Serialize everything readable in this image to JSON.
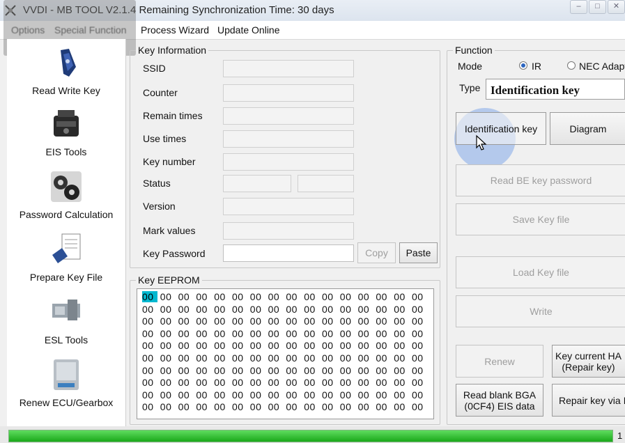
{
  "window": {
    "title": "VVDI - MB TOOL V2.1.4   Remaining Synchronization Time: 30 days"
  },
  "menu": {
    "items": [
      "Options",
      "Special Function",
      "Process Wizard",
      "Update Online"
    ]
  },
  "sidebar": {
    "items": [
      {
        "label": "Read Write Key",
        "icon": "key-fob-icon"
      },
      {
        "label": "EIS Tools",
        "icon": "eis-module-icon"
      },
      {
        "label": "Password Calculation",
        "icon": "gears-icon"
      },
      {
        "label": "Prepare Key File",
        "icon": "key-file-icon"
      },
      {
        "label": "ESL Tools",
        "icon": "esl-lock-icon"
      },
      {
        "label": "Renew ECU/Gearbox",
        "icon": "ecu-icon"
      }
    ]
  },
  "key_information": {
    "title": "Key Information",
    "fields": [
      {
        "label": "SSID",
        "value": ""
      },
      {
        "label": "Counter",
        "value": ""
      },
      {
        "label": "Remain times",
        "value": ""
      },
      {
        "label": "Use times",
        "value": ""
      },
      {
        "label": "Key number",
        "value": ""
      },
      {
        "label": "Status",
        "value": ""
      },
      {
        "label": "Version",
        "value": ""
      },
      {
        "label": "Mark values",
        "value": ""
      },
      {
        "label": "Key Password",
        "value": ""
      }
    ],
    "copy_label": "Copy",
    "paste_label": "Paste"
  },
  "eeprom": {
    "title": "Key EEPROM",
    "rows": [
      [
        "00",
        "00",
        "00",
        "00",
        "00",
        "00",
        "00",
        "00",
        "00",
        "00",
        "00",
        "00",
        "00",
        "00",
        "00",
        "00"
      ],
      [
        "00",
        "00",
        "00",
        "00",
        "00",
        "00",
        "00",
        "00",
        "00",
        "00",
        "00",
        "00",
        "00",
        "00",
        "00",
        "00"
      ],
      [
        "00",
        "00",
        "00",
        "00",
        "00",
        "00",
        "00",
        "00",
        "00",
        "00",
        "00",
        "00",
        "00",
        "00",
        "00",
        "00"
      ],
      [
        "00",
        "00",
        "00",
        "00",
        "00",
        "00",
        "00",
        "00",
        "00",
        "00",
        "00",
        "00",
        "00",
        "00",
        "00",
        "00"
      ],
      [
        "00",
        "00",
        "00",
        "00",
        "00",
        "00",
        "00",
        "00",
        "00",
        "00",
        "00",
        "00",
        "00",
        "00",
        "00",
        "00"
      ],
      [
        "00",
        "00",
        "00",
        "00",
        "00",
        "00",
        "00",
        "00",
        "00",
        "00",
        "00",
        "00",
        "00",
        "00",
        "00",
        "00"
      ],
      [
        "00",
        "00",
        "00",
        "00",
        "00",
        "00",
        "00",
        "00",
        "00",
        "00",
        "00",
        "00",
        "00",
        "00",
        "00",
        "00"
      ],
      [
        "00",
        "00",
        "00",
        "00",
        "00",
        "00",
        "00",
        "00",
        "00",
        "00",
        "00",
        "00",
        "00",
        "00",
        "00",
        "00"
      ],
      [
        "00",
        "00",
        "00",
        "00",
        "00",
        "00",
        "00",
        "00",
        "00",
        "00",
        "00",
        "00",
        "00",
        "00",
        "00",
        "00"
      ],
      [
        "00",
        "00",
        "00",
        "00",
        "00",
        "00",
        "00",
        "00",
        "00",
        "00",
        "00",
        "00",
        "00",
        "00",
        "00",
        "00"
      ]
    ]
  },
  "function": {
    "title": "Function",
    "mode_label": "Mode",
    "mode_options": [
      "IR",
      "NEC Adapt"
    ],
    "mode_selected": "IR",
    "type_label": "Type",
    "type_value": "Identification key",
    "buttons": {
      "identification_key": "Identification key",
      "diagram": "Diagram",
      "read_be_key_password": "Read BE key password",
      "save_key_file": "Save Key file",
      "load_key_file": "Load Key file",
      "write": "Write",
      "renew": "Renew",
      "key_current_hash": "Key current HA\n(Repair key)",
      "read_blank_bga": "Read blank BGA\n(0CF4) EIS data",
      "repair_key_via": "Repair key via I"
    }
  },
  "status": {
    "progress": 1.0,
    "right_text": "1"
  },
  "colors": {
    "selection": "#00b8d0",
    "progress": "#1aa81a",
    "cursor_halo": "#4682e6"
  }
}
